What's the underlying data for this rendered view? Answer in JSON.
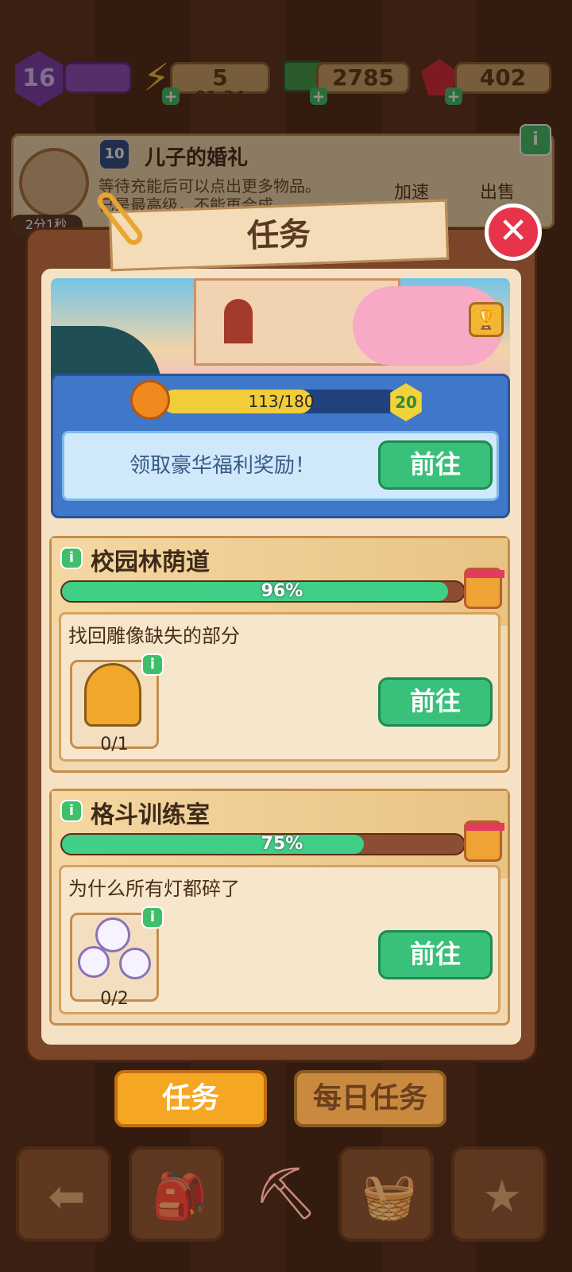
{
  "top_bar": {
    "level": "16",
    "energy": "5",
    "energy_timer": "01:34",
    "cash": "2785",
    "gems": "402"
  },
  "notification": {
    "level": "10",
    "title": "儿子的婚礼",
    "line1": "等待充能后可以点出更多物品。",
    "line2": "已是最高级，不能再合成。",
    "speed_label": "加速",
    "sell_label": "出售",
    "timer": "2分1秒",
    "info_icon": "i"
  },
  "dialog": {
    "title": "任务",
    "close_icon": "✕"
  },
  "featured": {
    "progress_text": "113/180",
    "progress": 0.63,
    "level_badge": "20",
    "reward_text": "领取豪华福利奖励！",
    "go_label": "前往"
  },
  "quests": [
    {
      "info": "i",
      "title": "校园林荫道",
      "progress_text": "96%",
      "progress": 0.96,
      "task_title": "找回雕像缺失的部分",
      "item_count": "0/1",
      "item_info": "i",
      "go_label": "前往"
    },
    {
      "info": "i",
      "title": "格斗训练室",
      "progress_text": "75%",
      "progress": 0.75,
      "task_title": "为什么所有灯都碎了",
      "item_count": "0/2",
      "item_info": "i",
      "go_label": "前往"
    }
  ],
  "tabs": {
    "tasks": "任务",
    "daily": "每日任务"
  },
  "nav_icons": [
    "back-arrow-icon",
    "backpack-icon",
    "trowel-icon",
    "basket-icon",
    "clipboard-star-icon"
  ],
  "colors": {
    "accent_green": "#39c07a",
    "tab_active": "#f5a623",
    "close_red": "#e8344a"
  }
}
